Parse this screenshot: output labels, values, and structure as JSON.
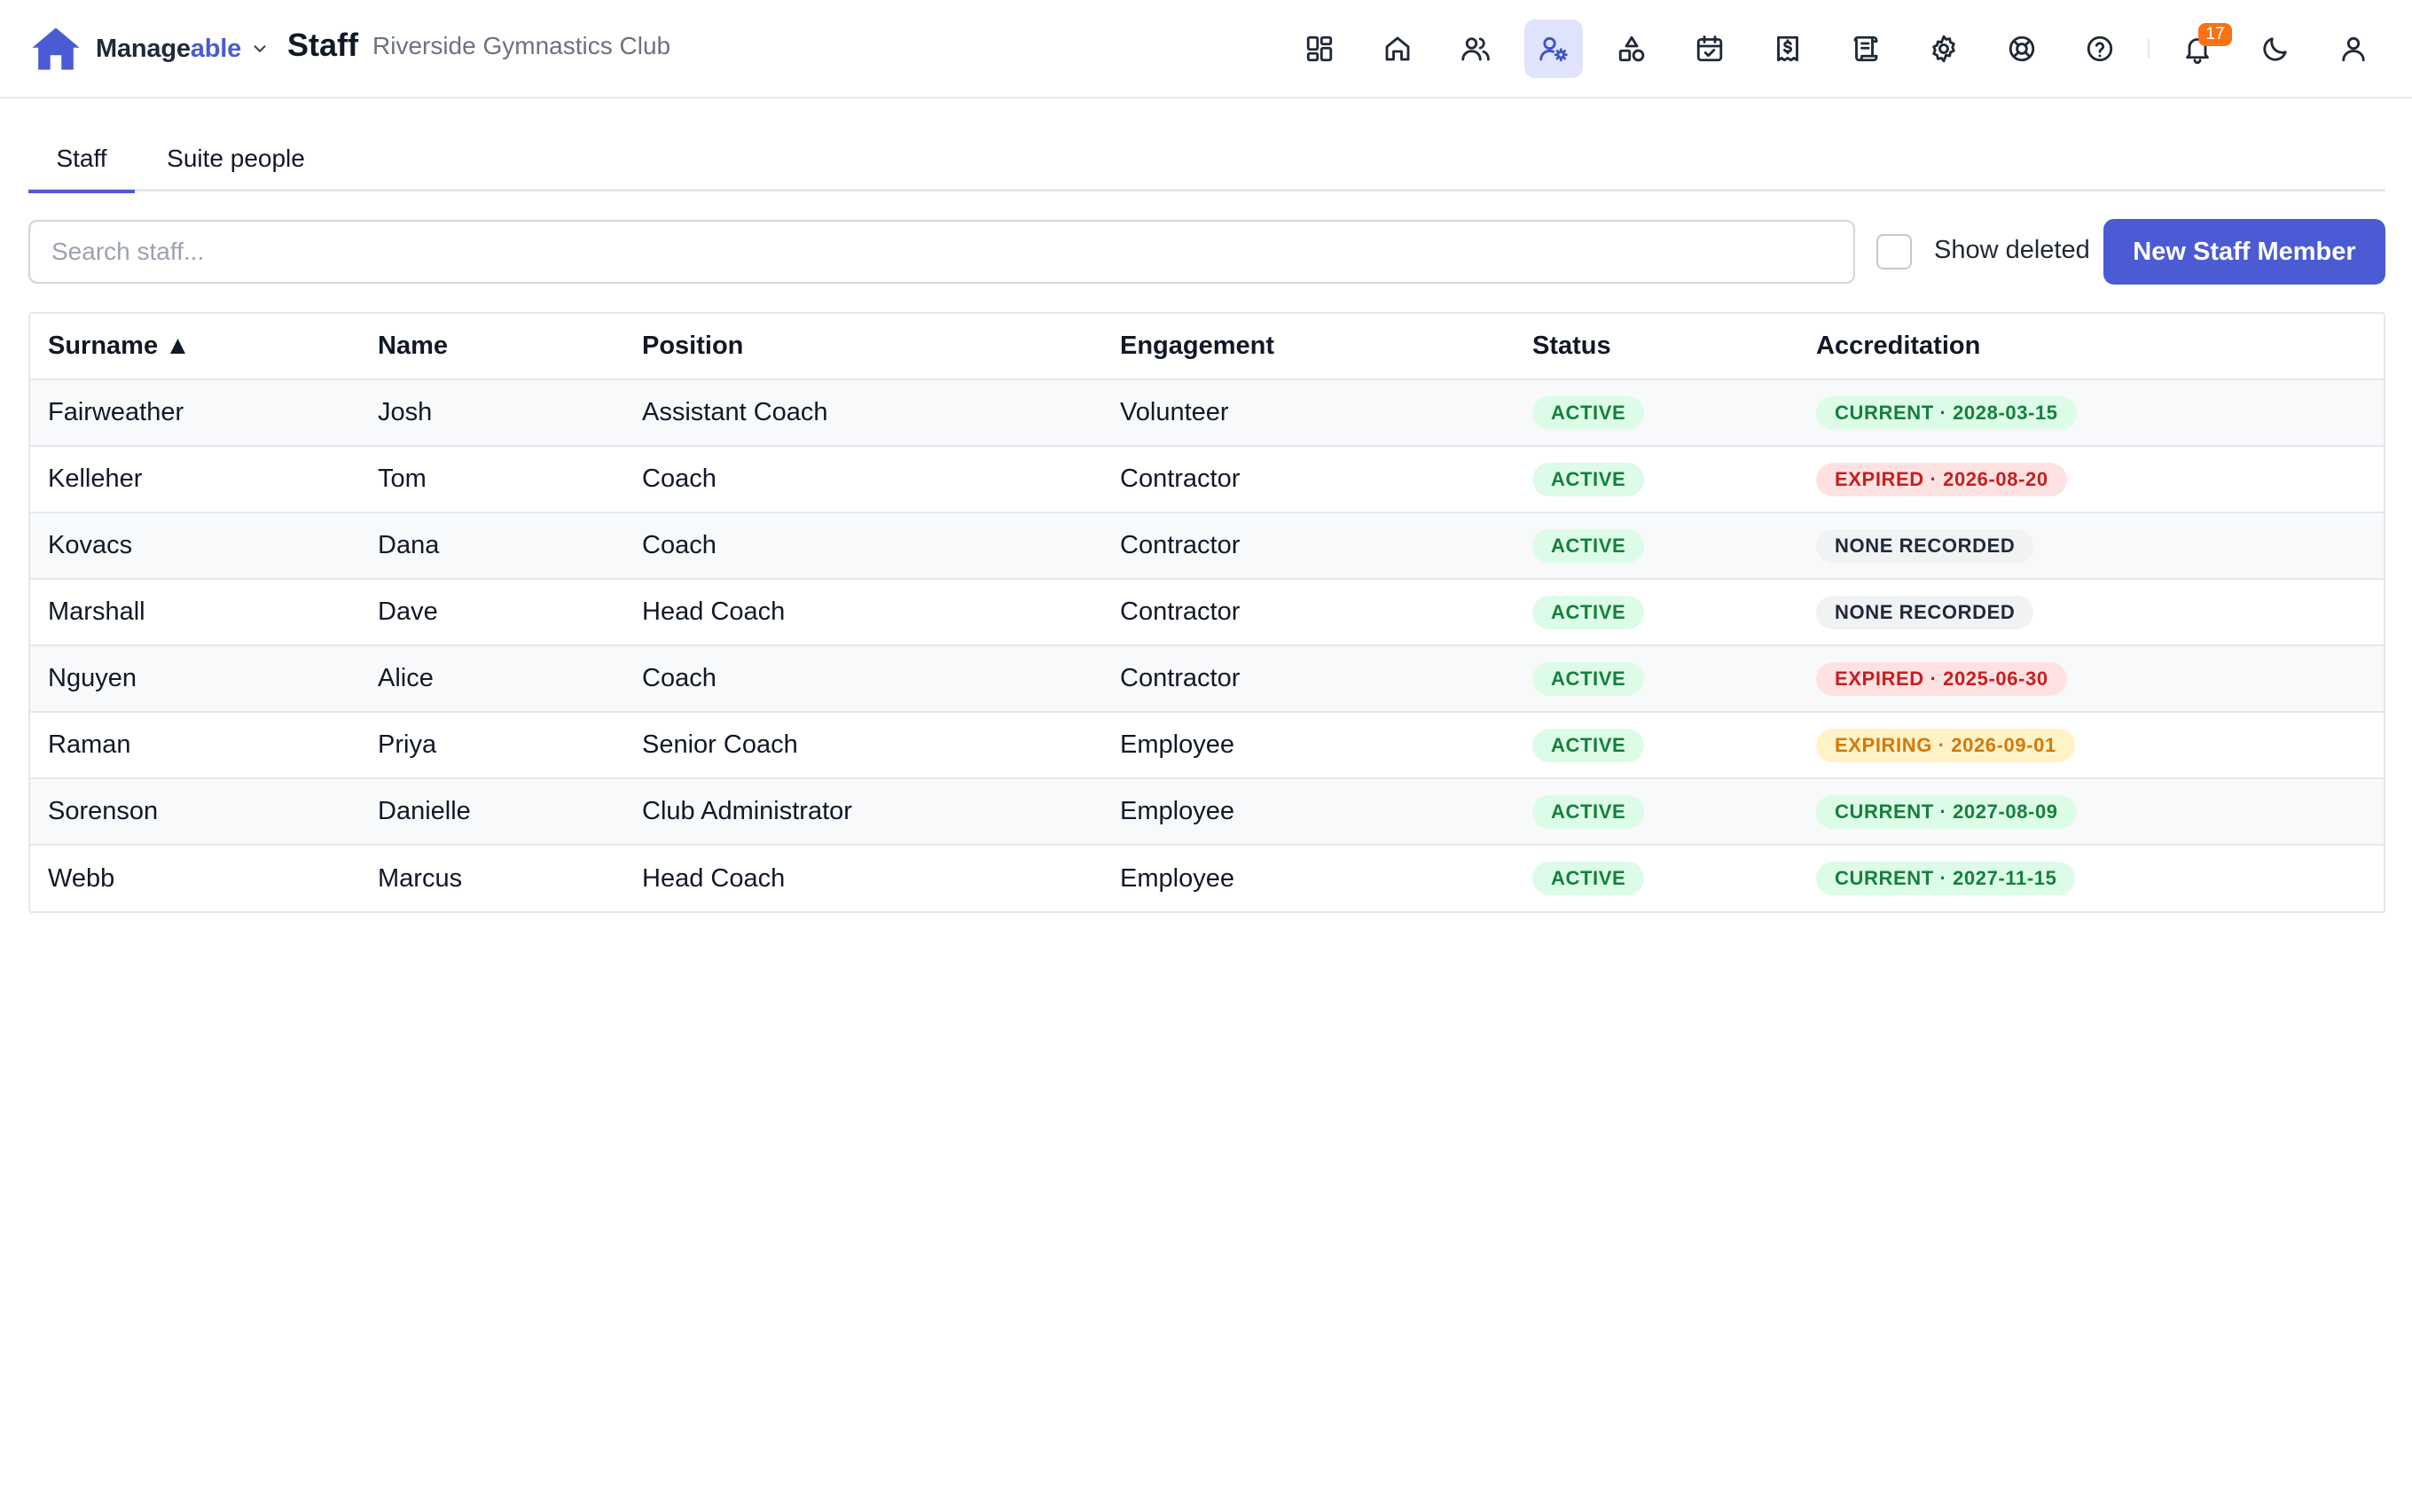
{
  "app": {
    "brand_part1": "Manage",
    "brand_part2": "able",
    "page_title": "Staff",
    "organization": "Riverside Gymnastics Club",
    "brand_color": "#4a5bd4"
  },
  "nav": {
    "icons": [
      "dashboard-icon",
      "home-icon",
      "people-icon",
      "staff-settings-icon",
      "shapes-icon",
      "calendar-check-icon",
      "invoice-icon",
      "receipt-icon",
      "settings-icon",
      "lifebuoy-icon",
      "help-icon"
    ],
    "active": "staff-settings-icon",
    "notification_count": "17"
  },
  "tabs": [
    {
      "label": "Staff",
      "active": true
    },
    {
      "label": "Suite people",
      "active": false
    }
  ],
  "toolbar": {
    "search_placeholder": "Search staff...",
    "search_value": "",
    "show_deleted_label": "Show deleted",
    "show_deleted_checked": false,
    "new_button_label": "New Staff Member"
  },
  "table": {
    "columns": [
      "Surname ▲",
      "Name",
      "Position",
      "Engagement",
      "Status",
      "Accreditation"
    ],
    "sort": {
      "column": "Surname",
      "direction": "ascending"
    },
    "rows": [
      {
        "surname": "Fairweather",
        "name": "Josh",
        "position": "Assistant Coach",
        "engagement": "Volunteer",
        "status": "ACTIVE",
        "accreditation": "CURRENT · 2028-03-15",
        "accreditation_state": "current"
      },
      {
        "surname": "Kelleher",
        "name": "Tom",
        "position": "Coach",
        "engagement": "Contractor",
        "status": "ACTIVE",
        "accreditation": "EXPIRED · 2026-08-20",
        "accreditation_state": "expired"
      },
      {
        "surname": "Kovacs",
        "name": "Dana",
        "position": "Coach",
        "engagement": "Contractor",
        "status": "ACTIVE",
        "accreditation": "NONE RECORDED",
        "accreditation_state": "none"
      },
      {
        "surname": "Marshall",
        "name": "Dave",
        "position": "Head Coach",
        "engagement": "Contractor",
        "status": "ACTIVE",
        "accreditation": "NONE RECORDED",
        "accreditation_state": "none"
      },
      {
        "surname": "Nguyen",
        "name": "Alice",
        "position": "Coach",
        "engagement": "Contractor",
        "status": "ACTIVE",
        "accreditation": "EXPIRED · 2025-06-30",
        "accreditation_state": "expired"
      },
      {
        "surname": "Raman",
        "name": "Priya",
        "position": "Senior Coach",
        "engagement": "Employee",
        "status": "ACTIVE",
        "accreditation": "EXPIRING · 2026-09-01",
        "accreditation_state": "expiring"
      },
      {
        "surname": "Sorenson",
        "name": "Danielle",
        "position": "Club Administrator",
        "engagement": "Employee",
        "status": "ACTIVE",
        "accreditation": "CURRENT · 2027-08-09",
        "accreditation_state": "current"
      },
      {
        "surname": "Webb",
        "name": "Marcus",
        "position": "Head Coach",
        "engagement": "Employee",
        "status": "ACTIVE",
        "accreditation": "CURRENT · 2027-11-15",
        "accreditation_state": "current"
      }
    ]
  },
  "colors": {
    "status_active": "#15803d",
    "current": "#15803d",
    "expired": "#c81e1e",
    "expiring": "#d97706",
    "none": "#1f2937"
  }
}
